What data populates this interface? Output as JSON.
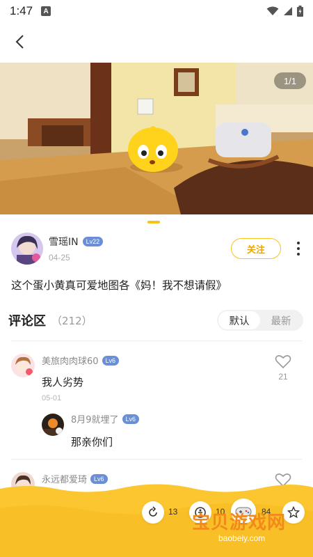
{
  "status_bar": {
    "time": "1:47",
    "notification_badge": "A"
  },
  "post": {
    "image_counter": "1/1",
    "image_caption": "",
    "author": {
      "name": "雪瑶IN",
      "level": "Lv22",
      "date": "04-25"
    },
    "follow_label": "关注",
    "text": "这个蛋小黄真可爱地图各《妈！我不想请假》"
  },
  "comments": {
    "title": "评论区",
    "count": "（212）",
    "sort_options": [
      "默认",
      "最新"
    ],
    "items": [
      {
        "name": "美旅肉肉球60",
        "level": "Lv6",
        "text": "我人劣势",
        "date": "05-01",
        "likes": "21",
        "reply": {
          "name": "8月9就埋了",
          "level": "Lv6",
          "text": "那亲你们"
        }
      },
      {
        "name": "永远都爱琦",
        "level": "Lv6"
      }
    ]
  },
  "bottom_bar": {
    "share_count": "13",
    "reward_count": "10",
    "comment_count": "84"
  },
  "watermark": {
    "text": "宝贝游戏网",
    "url": "baobeiy.com"
  },
  "colors": {
    "accent": "#f7c21c",
    "level_badge": "#6a8fd6",
    "bottom_bar": "#fbc62f"
  }
}
